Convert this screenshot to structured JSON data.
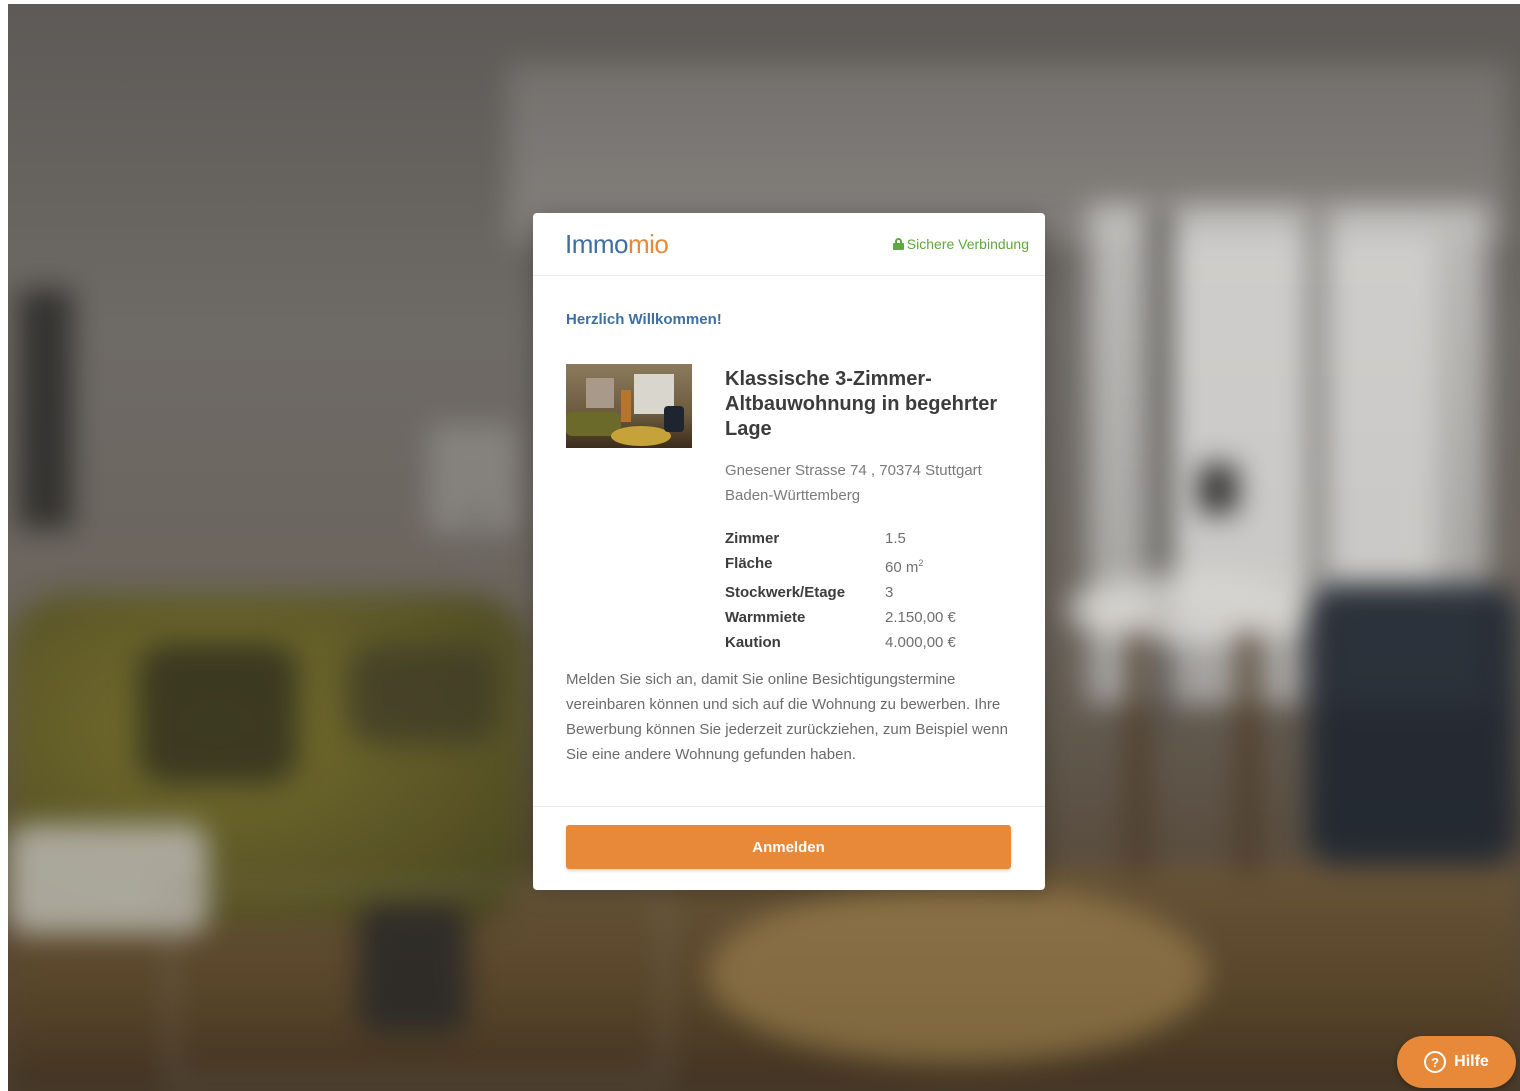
{
  "brand": {
    "logo_part1": "Immo",
    "logo_part2": "mio",
    "secure_label": "Sichere Verbindung",
    "primary_color": "#3f6fa1",
    "accent_color": "#e8893a",
    "secure_color": "#5fa83b"
  },
  "welcome": "Herzlich Willkommen!",
  "listing": {
    "title": "Klassische 3-Zimmer-Altbauwohnung in begehrter Lage",
    "address_line1": "Gnesener Strasse 74 , 70374 Stuttgart",
    "address_line2": "Baden-Württemberg",
    "facts": [
      {
        "label": "Zimmer",
        "value": "1.5"
      },
      {
        "label": "Fläche",
        "value": "60 m",
        "sup": "2"
      },
      {
        "label": "Stockwerk/Etage",
        "value": "3"
      },
      {
        "label": "Warmmiete",
        "value": "2.150,00 €"
      },
      {
        "label": "Kaution",
        "value": "4.000,00 €"
      }
    ]
  },
  "description": "Melden Sie sich an, damit Sie online Besichtigungstermine vereinbaren können und sich auf die Wohnung zu bewerben. Ihre Bewerbung können Sie jederzeit zurückziehen, zum Beispiel wenn Sie eine andere Wohnung gefunden haben.",
  "login_button": "Anmelden",
  "help": {
    "icon": "?",
    "label": "Hilfe",
    "icon_name": "question-circle-icon"
  }
}
